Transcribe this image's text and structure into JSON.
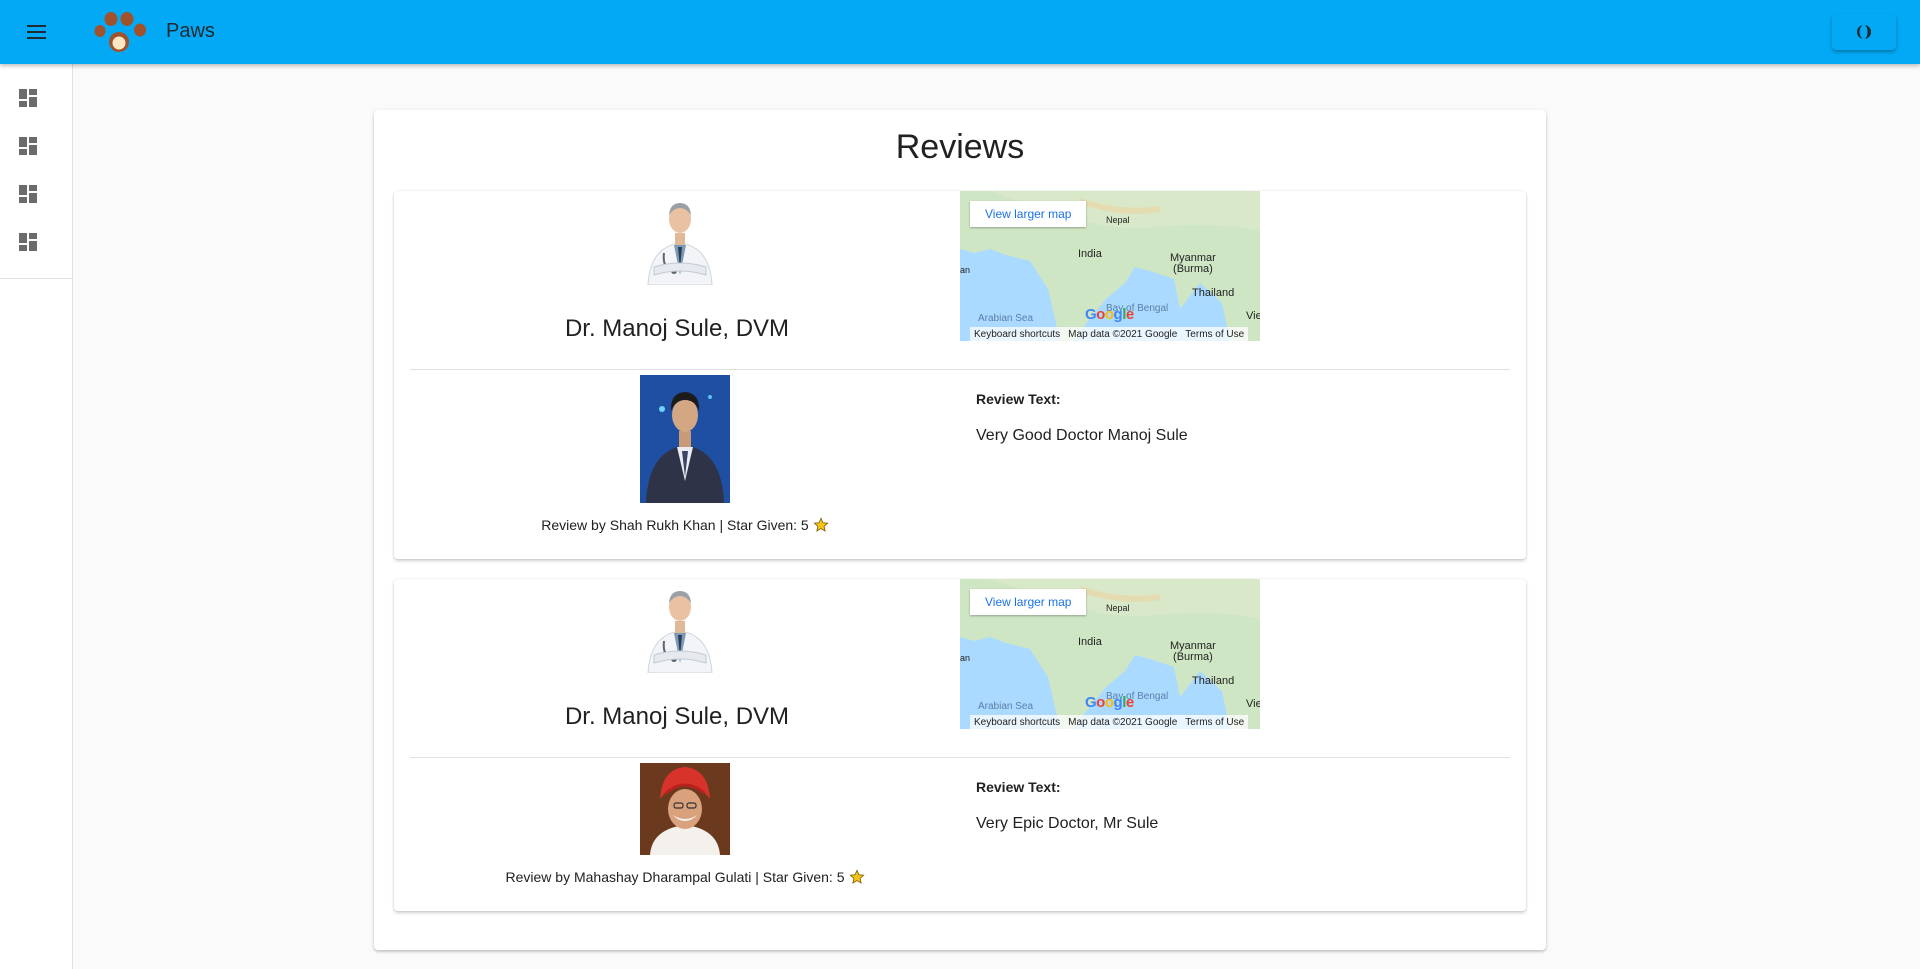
{
  "app": {
    "title": "Paws",
    "logo": "paw-logo",
    "theme_toggle_icon": "half-moon-icon"
  },
  "colors": {
    "appbar": "#03a9f4",
    "background": "#fafafa",
    "logo_brown": "#a0522d",
    "star": "#f5c518"
  },
  "sidebar": {
    "items": [
      {
        "icon": "dashboard-icon"
      },
      {
        "icon": "dashboard-icon"
      },
      {
        "icon": "dashboard-icon"
      },
      {
        "icon": "dashboard-icon"
      }
    ]
  },
  "page": {
    "title": "Reviews"
  },
  "map": {
    "link": "View larger map",
    "labels": {
      "nepal": "Nepal",
      "india": "India",
      "myanmar": "Myanmar\n(Burma)",
      "thailand": "Thailand",
      "arabian_sea": "Arabian Sea",
      "bay": "Bay of Bengal",
      "left_cut": "an",
      "right_cut": "Viet"
    },
    "footer": {
      "shortcuts": "Keyboard shortcuts",
      "data": "Map data ©2021 Google",
      "terms": "Terms of Use"
    },
    "logo_text": "Google"
  },
  "reviews": [
    {
      "doctor_name": "Dr. Manoj Sule, DVM",
      "review_by": "Review by Shah Rukh Khan | Star Given: 5",
      "review_text_label": "Review Text:",
      "review_text": "Very Good Doctor Manoj Sule",
      "stars": 5
    },
    {
      "doctor_name": "Dr. Manoj Sule, DVM",
      "review_by": "Review by Mahashay Dharampal Gulati | Star Given: 5",
      "review_text_label": "Review Text:",
      "review_text": "Very Epic Doctor, Mr Sule",
      "stars": 5
    }
  ]
}
